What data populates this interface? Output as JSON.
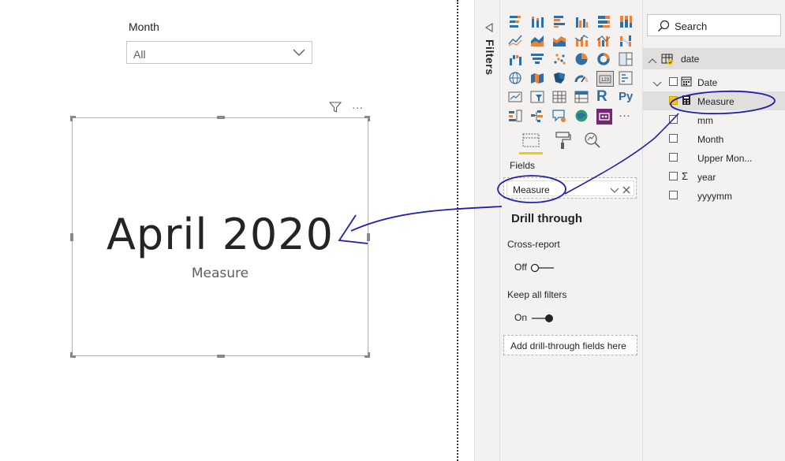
{
  "slicer": {
    "title": "Month",
    "value": "All"
  },
  "card": {
    "value": "April 2020",
    "label": "Measure"
  },
  "filters_pane": {
    "label": "Filters"
  },
  "viz_pane": {
    "fields_section_label": "Fields",
    "field_well_item": "Measure",
    "drill_through_title": "Drill through",
    "cross_report": {
      "label": "Cross-report",
      "state": "Off"
    },
    "keep_filters": {
      "label": "Keep all filters",
      "state": "On"
    },
    "drop_zone_text": "Add drill-through fields here",
    "r_visual_label": "R",
    "py_visual_label": "Py",
    "more_visuals": "···"
  },
  "fields_pane": {
    "search_placeholder": "Search",
    "table_name": "date",
    "fields": [
      {
        "name": "Date",
        "icon": "calendar-icon"
      },
      {
        "name": "Measure",
        "icon": "calculator-icon"
      },
      {
        "name": "mm",
        "icon": ""
      },
      {
        "name": "Month",
        "icon": ""
      },
      {
        "name": "Upper Mon...",
        "icon": ""
      },
      {
        "name": "year",
        "icon": "sigma-icon"
      },
      {
        "name": "yyyymm",
        "icon": ""
      }
    ]
  },
  "colors": {
    "accent": "#f2c811",
    "annotation_ink": "#1f1fb4",
    "viz_blue": "#2f6fa7",
    "viz_orange": "#e8833a"
  }
}
